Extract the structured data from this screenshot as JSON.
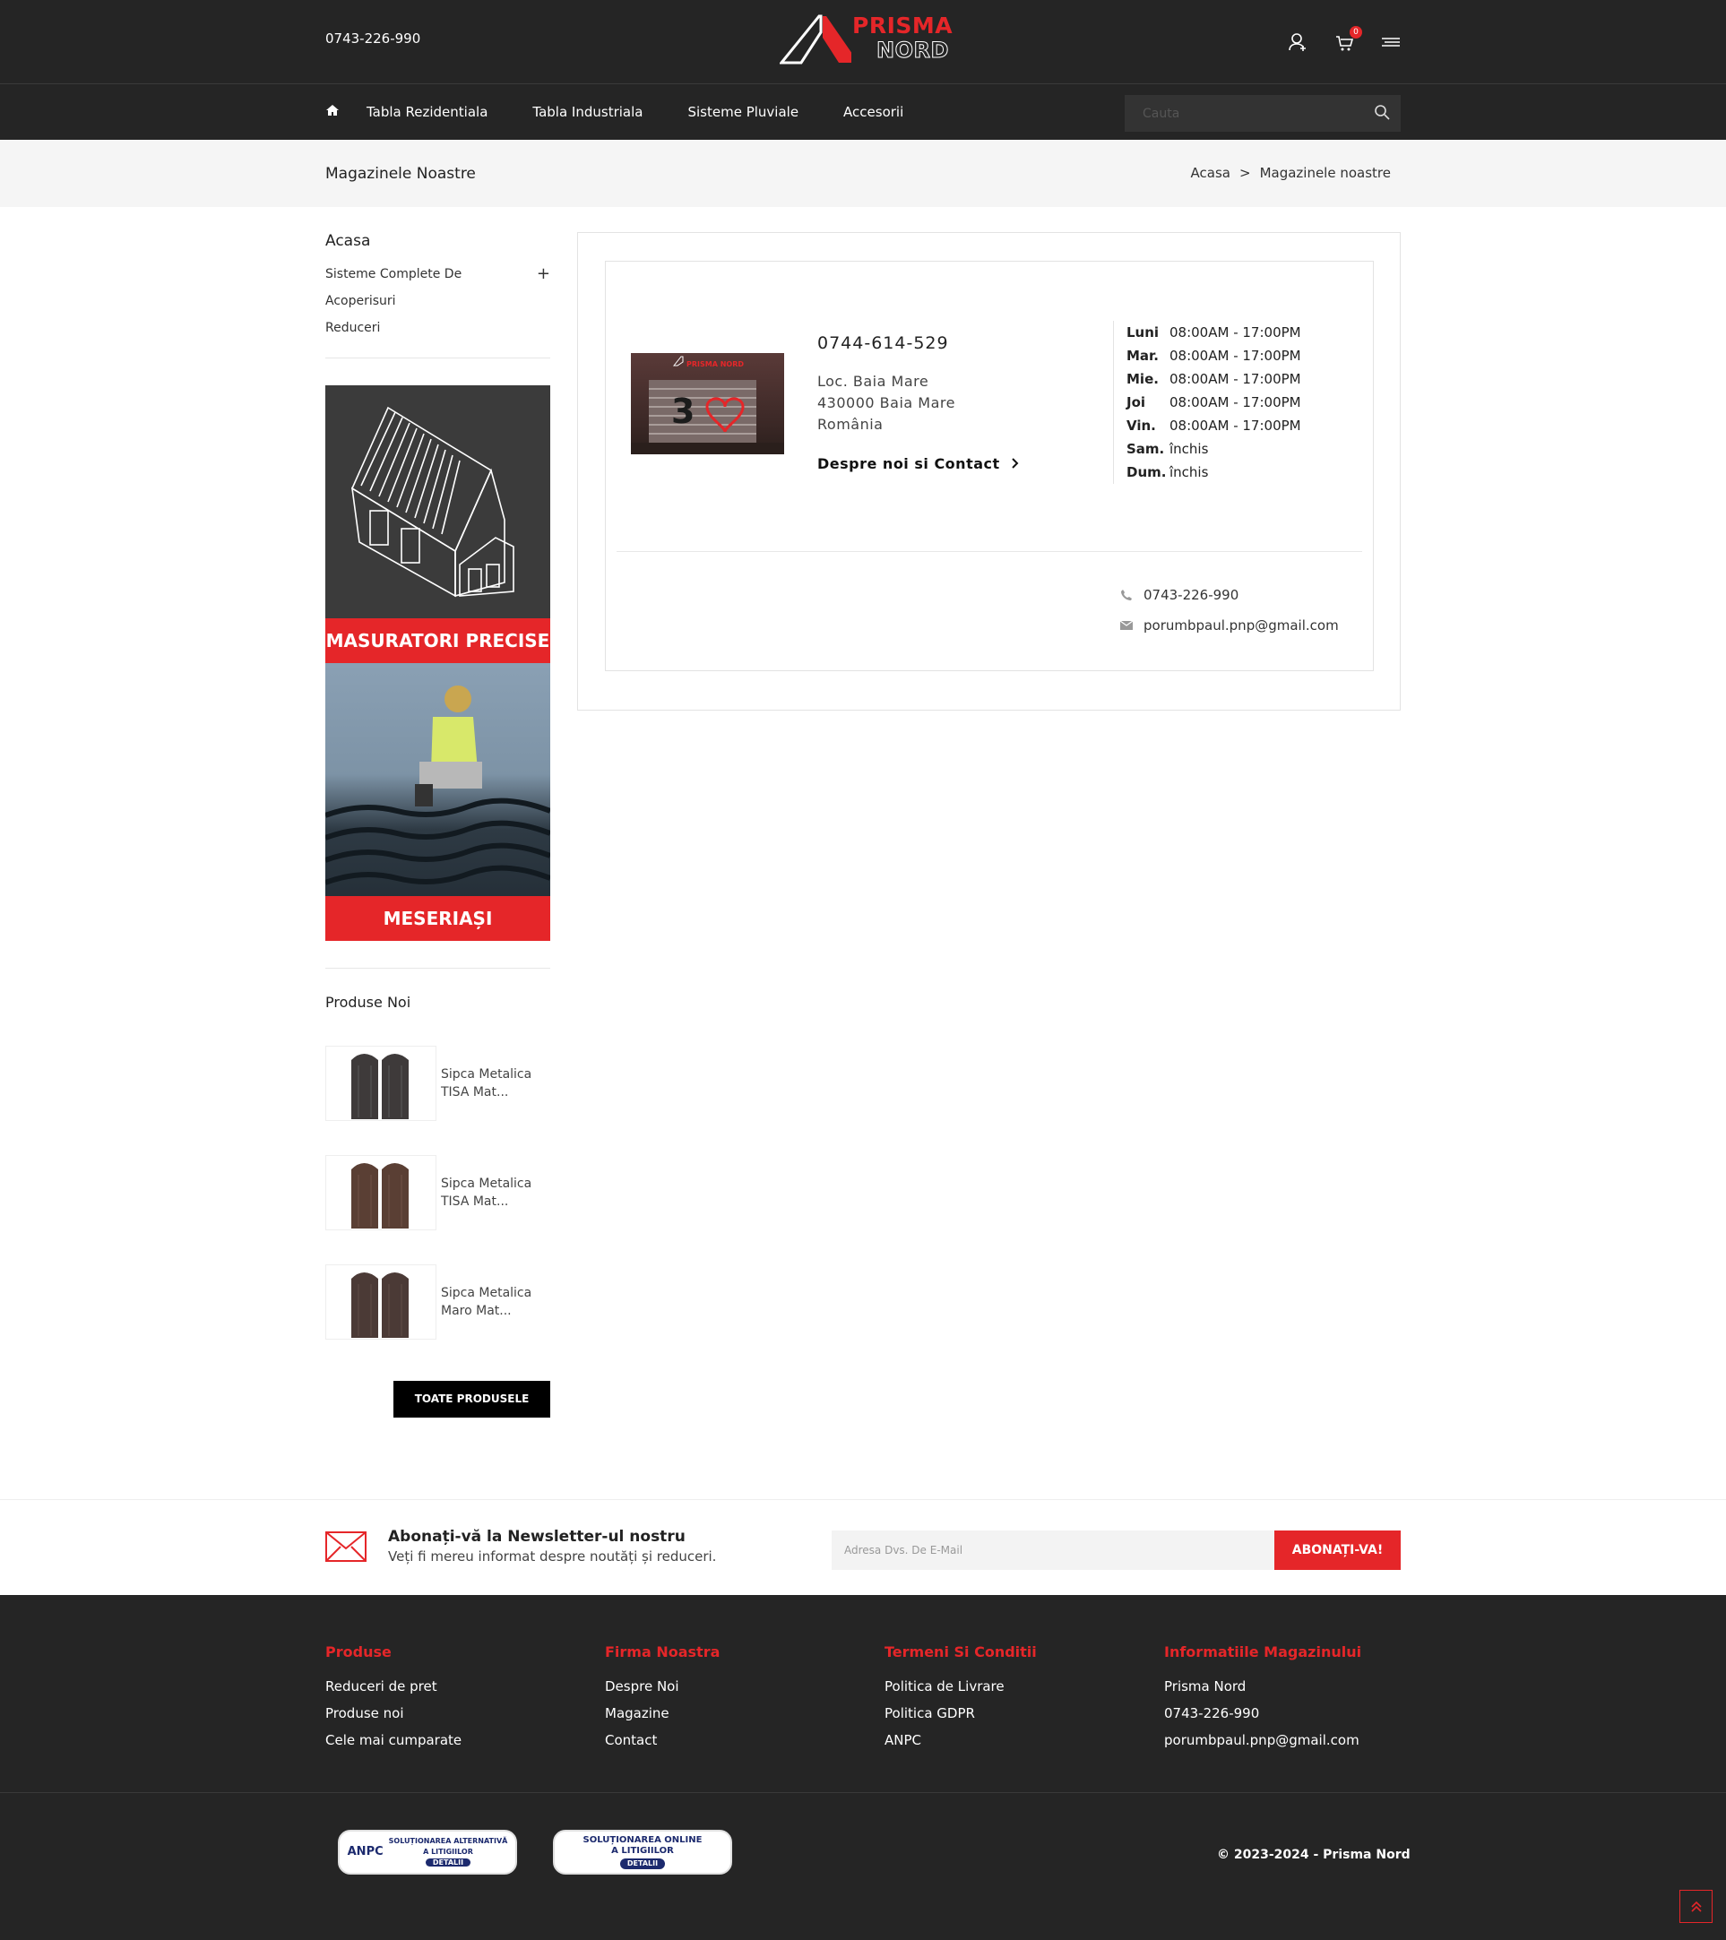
{
  "header": {
    "phone": "0743-226-990",
    "logo": {
      "line1": "PRISMA",
      "line2": "NORD"
    },
    "cart_count": "0",
    "icons": [
      "user-icon",
      "cart-icon",
      "menu-icon"
    ]
  },
  "nav": {
    "items": [
      "Tabla Rezidentiala",
      "Tabla Industriala",
      "Sisteme Pluviale",
      "Accesorii"
    ],
    "search_placeholder": "Cauta"
  },
  "breadcrumb": {
    "title": "Magazinele Noastre",
    "crumbs": [
      "Acasa",
      "Magazinele noastre"
    ],
    "separator": ">"
  },
  "sidebar": {
    "heading": "Acasa",
    "categories": [
      "Sisteme Complete De",
      "Acoperisuri",
      "Reduceri"
    ],
    "banners": [
      "MASURATORI PRECISE",
      "MESERIAȘI"
    ],
    "new_products_heading": "Produse Noi",
    "products": [
      {
        "name": "Sipca Metalica TISA Mat...",
        "color": "#3e3a3a"
      },
      {
        "name": "Sipca Metalica TISA Mat...",
        "color": "#5a3f34"
      },
      {
        "name": "Sipca Metalica Maro Mat...",
        "color": "#4b3a36"
      }
    ],
    "all_products_button": "TOATE PRODUSELE"
  },
  "store": {
    "image_text": "PRISMA NORD",
    "phone": "0744-614-529",
    "address": [
      "Loc. Baia Mare",
      "430000 Baia Mare",
      "România"
    ],
    "more_link": "Despre noi si Contact",
    "hours": [
      {
        "day": "Luni",
        "time": "08:00AM - 17:00PM"
      },
      {
        "day": "Mar.",
        "time": "08:00AM - 17:00PM"
      },
      {
        "day": "Mie.",
        "time": "08:00AM - 17:00PM"
      },
      {
        "day": "Joi",
        "time": "08:00AM - 17:00PM"
      },
      {
        "day": "Vin.",
        "time": "08:00AM - 17:00PM"
      },
      {
        "day": "Sam.",
        "time": "închis"
      },
      {
        "day": "Dum.",
        "time": "închis"
      }
    ],
    "contact_phone": "0743-226-990",
    "contact_email": "porumbpaul.pnp@gmail.com"
  },
  "newsletter": {
    "heading": "Abonați-vă la Newsletter-ul nostru",
    "subheading": "Veți fi mereu informat despre noutăți și reduceri.",
    "placeholder": "Adresa Dvs. De E-Mail",
    "button": "ABONAȚI-VA!"
  },
  "footer": {
    "columns": [
      {
        "heading": "Produse",
        "items": [
          "Reduceri de pret",
          "Produse noi",
          "Cele mai cumparate"
        ]
      },
      {
        "heading": "Firma Noastra",
        "items": [
          "Despre Noi",
          "Magazine",
          "Contact"
        ]
      },
      {
        "heading": "Termeni Si Conditii",
        "items": [
          "Politica de Livrare",
          "Politica GDPR",
          "ANPC"
        ]
      },
      {
        "heading": "Informatiile Magazinului",
        "items": [
          "Prisma Nord",
          "0743-226-990",
          "porumbpaul.pnp@gmail.com"
        ]
      }
    ],
    "badges": [
      {
        "line1": "ANPC",
        "line2": "SOLUȚIONAREA ALTERNATIVĂ",
        "line3": "A LITIGIILOR",
        "detail": "DETALII"
      },
      {
        "line1": "",
        "line2": "SOLUȚIONAREA ONLINE",
        "line3": "A LITIGIILOR",
        "detail": "DETALII"
      }
    ],
    "copyright": "© 2023-2024 - Prisma Nord"
  },
  "colors": {
    "brand": "#e52629",
    "dark": "#252525"
  }
}
